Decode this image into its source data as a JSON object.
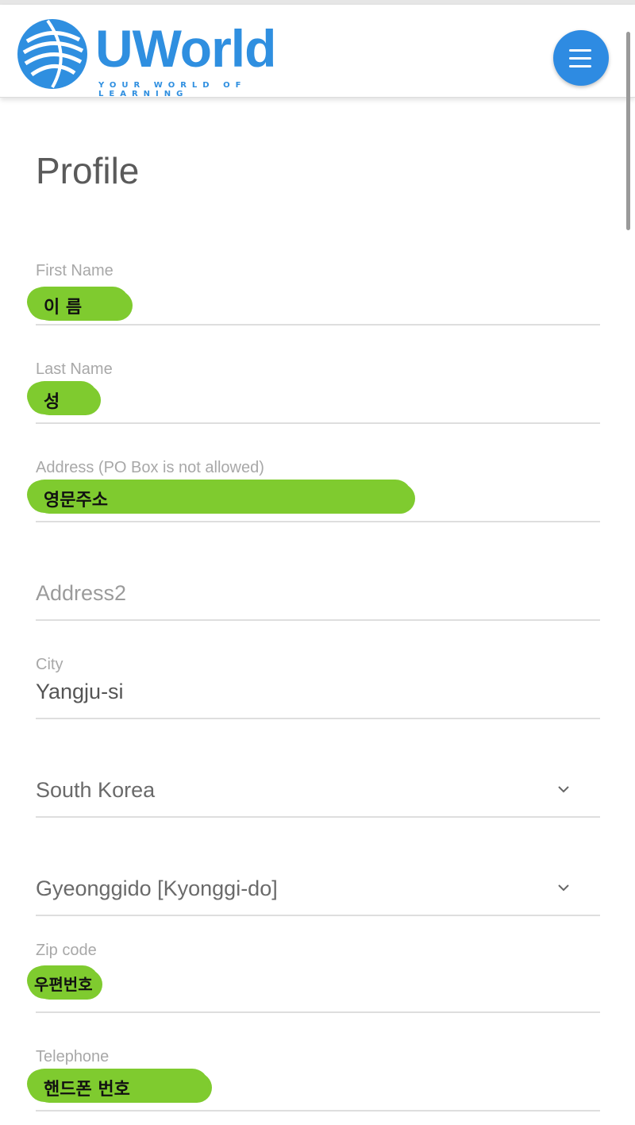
{
  "header": {
    "logo_text": "UWorld",
    "logo_tagline": "YOUR WORLD OF LEARNING",
    "brand_color": "#2f8fe0"
  },
  "page": {
    "title": "Profile"
  },
  "form": {
    "first_name": {
      "label": "First Name",
      "value": "이 름"
    },
    "last_name": {
      "label": "Last Name",
      "value": "성"
    },
    "address": {
      "label": "Address (PO Box is not allowed)",
      "value": "영문주소"
    },
    "address2": {
      "placeholder": "Address2"
    },
    "city": {
      "label": "City",
      "value": "Yangju-si"
    },
    "country": {
      "value": "South Korea"
    },
    "state": {
      "value": "Gyeonggido [Kyonggi-do]"
    },
    "zip": {
      "label": "Zip code",
      "value": "우편번호"
    },
    "telephone": {
      "label": "Telephone",
      "value": "핸드폰 번호"
    }
  },
  "redaction_color": "#7fcb2f"
}
